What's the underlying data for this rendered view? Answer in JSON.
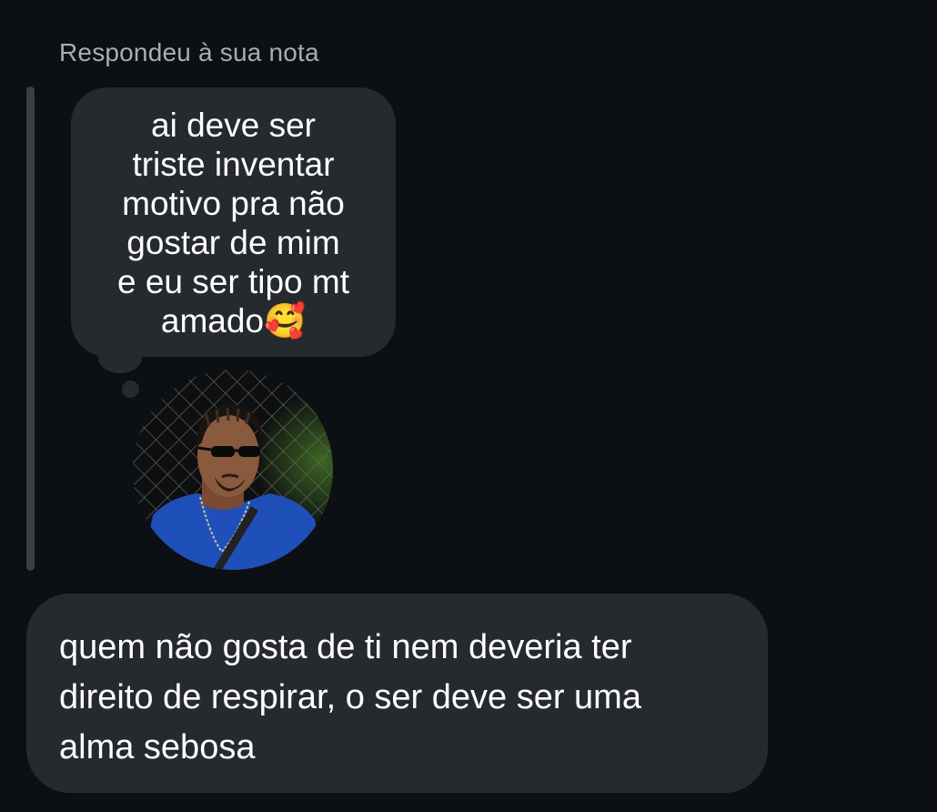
{
  "thread": {
    "reply_context_label": "Respondeu à sua nota",
    "note": {
      "text": "ai deve ser\ntriste inventar\nmotivo pra não\ngostar de mim\ne eu ser tipo mt\namado🥰"
    },
    "avatar_icon": "profile-photo",
    "message": {
      "text": "quem não gosta de ti nem deveria ter\ndireito de respirar, o ser deve ser uma\nalma sebosa"
    }
  },
  "colors": {
    "background": "#0c1014",
    "bubble": "#262a2e",
    "reply_bar": "#3a3f45",
    "secondary_text": "#a8adb4",
    "primary_text": "#ffffff"
  }
}
